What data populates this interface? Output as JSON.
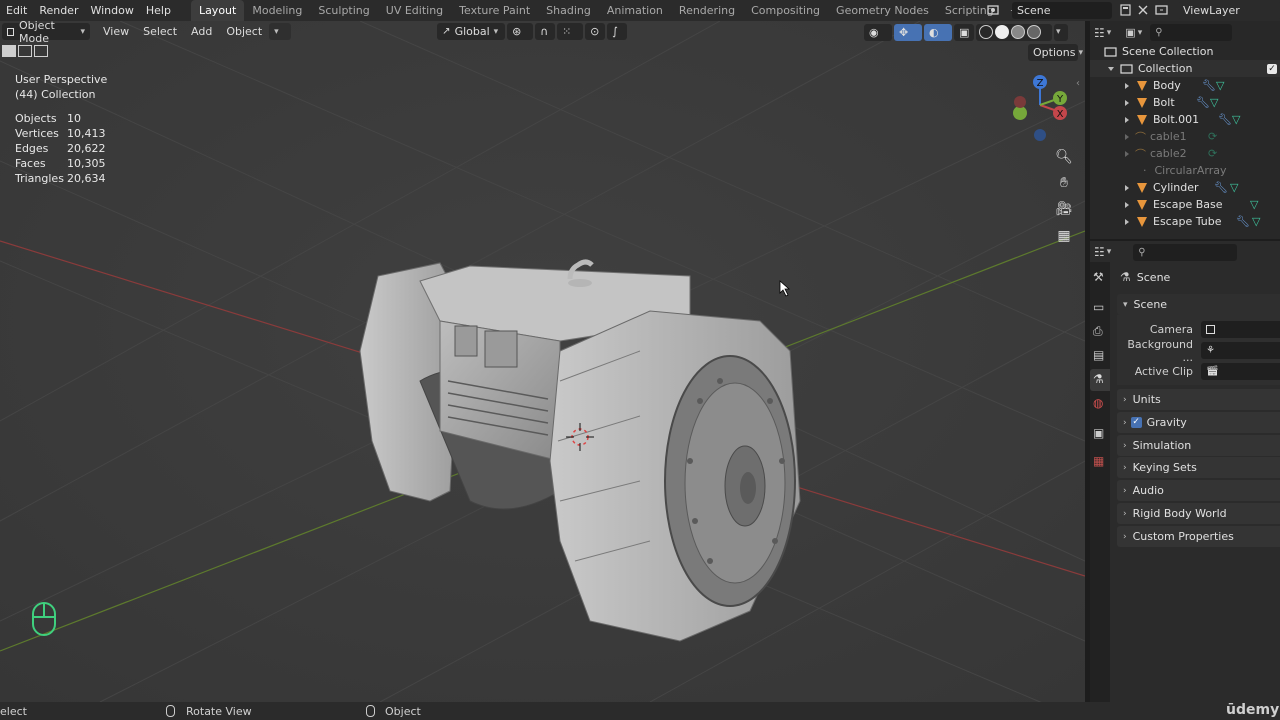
{
  "topbar": {
    "menus": [
      "Edit",
      "Render",
      "Window",
      "Help"
    ],
    "workspaces": [
      "Layout",
      "Modeling",
      "Sculpting",
      "UV Editing",
      "Texture Paint",
      "Shading",
      "Animation",
      "Rendering",
      "Compositing",
      "Geometry Nodes",
      "Scripting"
    ],
    "active_workspace": "Layout",
    "add_tab": "+",
    "scene_name": "Scene",
    "view_layer": "ViewLayer"
  },
  "viewport_header": {
    "mode": "Object Mode",
    "menus": [
      "View",
      "Select",
      "Add",
      "Object"
    ],
    "transform_orientation": "Global",
    "options_label": "Options"
  },
  "overlay_stats": {
    "view_name": "User Perspective",
    "collection": "(44) Collection",
    "rows": [
      {
        "label": "Objects",
        "value": "10"
      },
      {
        "label": "Vertices",
        "value": "10,413"
      },
      {
        "label": "Edges",
        "value": "20,622"
      },
      {
        "label": "Faces",
        "value": "10,305"
      },
      {
        "label": "Triangles",
        "value": "20,634"
      }
    ]
  },
  "gizmo": {
    "x": "X",
    "y": "Y",
    "z": "Z"
  },
  "outliner": {
    "root": "Scene Collection",
    "collection": "Collection",
    "items": [
      {
        "name": "Body",
        "dim": false,
        "type": "mesh"
      },
      {
        "name": "Bolt",
        "dim": false,
        "type": "mesh"
      },
      {
        "name": "Bolt.001",
        "dim": false,
        "type": "mesh"
      },
      {
        "name": "cable1",
        "dim": true,
        "type": "curve"
      },
      {
        "name": "cable2",
        "dim": true,
        "type": "curve"
      },
      {
        "name": "CircularArray",
        "dim": true,
        "type": "empty"
      },
      {
        "name": "Cylinder",
        "dim": false,
        "type": "mesh"
      },
      {
        "name": "Escape Base",
        "dim": false,
        "type": "mesh"
      },
      {
        "name": "Escape Tube",
        "dim": false,
        "type": "mesh"
      }
    ]
  },
  "properties": {
    "context_title": "Scene",
    "scene_panel": "Scene",
    "fields": [
      {
        "label": "Camera"
      },
      {
        "label": "Background ..."
      },
      {
        "label": "Active Clip"
      }
    ],
    "panels": [
      "Units",
      "Gravity",
      "Simulation",
      "Keying Sets",
      "Audio",
      "Rigid Body World",
      "Custom Properties"
    ]
  },
  "statusbar": {
    "left": "elect",
    "middle": "Rotate View",
    "right": "Object"
  },
  "watermark": "ūdemy",
  "colors": {
    "accent": "#4772b3",
    "mesh_icon": "#e8963c",
    "modifier_icon": "#6ea0e0",
    "vertex_group_icon": "#3fc7a0",
    "axis_x": "#c4464b",
    "axis_y": "#76a83a",
    "axis_z": "#3d77d6"
  }
}
